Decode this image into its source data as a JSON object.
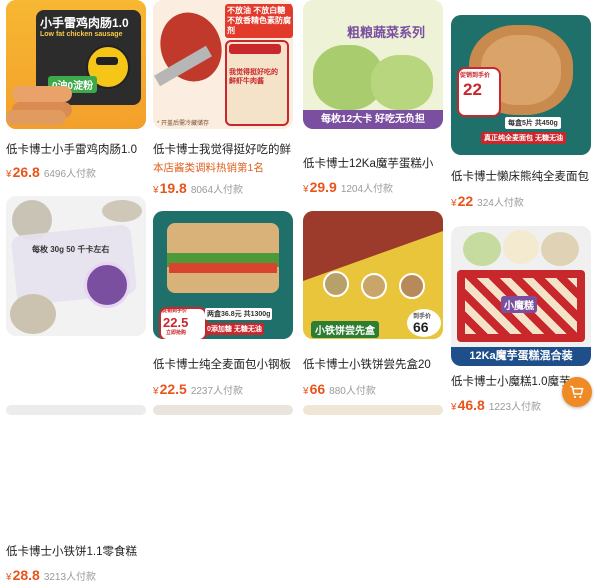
{
  "products": [
    {
      "title": "低卡博士小手雷鸡肉肠1.0",
      "currency": "¥",
      "price": "26.8",
      "sold": "6496人付款",
      "image_text": {
        "headline": "小手雷鸡肉肠1.0",
        "subline": "Low fat chicken sausage",
        "badge": "0油0淀粉"
      }
    },
    {
      "title": "低卡博士我觉得挺好吃的鲜",
      "subtitle": "本店酱类调料热销第1名",
      "currency": "¥",
      "price": "19.8",
      "sold": "8064人付款",
      "image_text": {
        "badge": "不放油 不放白糖 不放香精色素防腐剂",
        "jar_label": "我觉得挺好吃的 鲜虾牛肉酱",
        "note": "* 开盖后需冷藏储存"
      }
    },
    {
      "title": "低卡博士12Ka魔芋蛋糕小",
      "currency": "¥",
      "price": "29.9",
      "sold": "1204人付款",
      "image_text": {
        "headline": "粗粮蔬菜系列",
        "banner": "每枚12大卡 好吃无负担"
      }
    },
    {
      "title": "低卡博士懒床熊纯全麦面包",
      "currency": "¥",
      "price": "22",
      "sold": "324人付款",
      "image_text": {
        "promo_label": "促销到手价",
        "promo_price": "22",
        "tag1": "每盒5片 共450g",
        "tag2": "真正纯全麦面包  无糖无油"
      }
    },
    {
      "title": "低卡博士小铁饼1.1零食糕",
      "currency": "¥",
      "price": "28.8",
      "sold": "3213人付款",
      "image_text": {
        "text": "每枚 30g 50 千卡左右"
      }
    },
    {
      "title": "低卡博士纯全麦面包小钢板",
      "currency": "¥",
      "price": "22.5",
      "sold": "2237人付款",
      "image_text": {
        "promo_label": "促销到手价",
        "promo_price": "22.5",
        "tag1": "两盒36.8元  共1300g",
        "tag2": "0添加糖 无糖无油",
        "tag3": "立即抢购"
      }
    },
    {
      "title": "低卡博士小铁饼尝先盒20",
      "currency": "¥",
      "price": "66",
      "sold": "880人付款",
      "image_text": {
        "banner": "小铁饼尝先盒",
        "promo_label": "到手价",
        "promo_price": "66"
      }
    },
    {
      "title": "低卡博士小魔糕1.0魔芋",
      "currency": "¥",
      "price": "46.8",
      "sold": "1223人付款",
      "image_text": {
        "banner": "12Ka魔芋蛋糕混合装",
        "box_text": "小魔糕"
      }
    }
  ],
  "colors": {
    "accent": "#e8551c",
    "fab": "#f08a24"
  },
  "fab_icon": "cart-icon"
}
